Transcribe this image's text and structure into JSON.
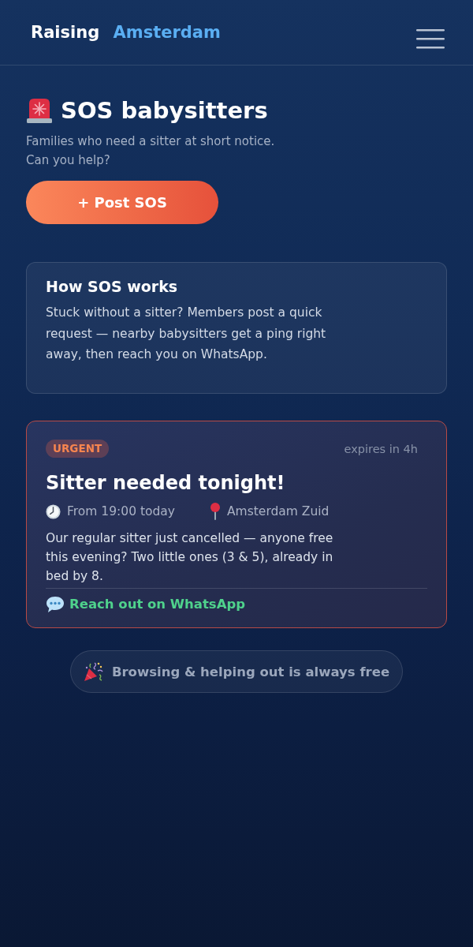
{
  "header": {
    "logo": {
      "text": "Raising",
      "accent": "Amsterdam"
    }
  },
  "intro": {
    "title": "SOS babysitters",
    "subtitle_lines": [
      "Families who need a sitter at short notice.",
      "Can you help?"
    ],
    "post_button": "+ Post SOS"
  },
  "info_card": {
    "title": "How SOS works",
    "body": "Stuck without a sitter? Members post a quick request — nearby babysitters get a ping right away, then reach you on WhatsApp."
  },
  "posts": [
    {
      "badge": "URGENT",
      "expires": "expires in 4h",
      "title": "Sitter needed tonight!",
      "meta": [
        {
          "kind": "time",
          "text": "From 19:00 today"
        },
        {
          "kind": "location",
          "text": "Amsterdam Zuid"
        }
      ],
      "body": "Our regular sitter just cancelled — anyone free this evening? Two little ones (3 & 5), already in bed by 8.",
      "contact_link": "Reach out on WhatsApp"
    }
  ],
  "promo": {
    "text": "Browsing & helping out is always free"
  }
}
